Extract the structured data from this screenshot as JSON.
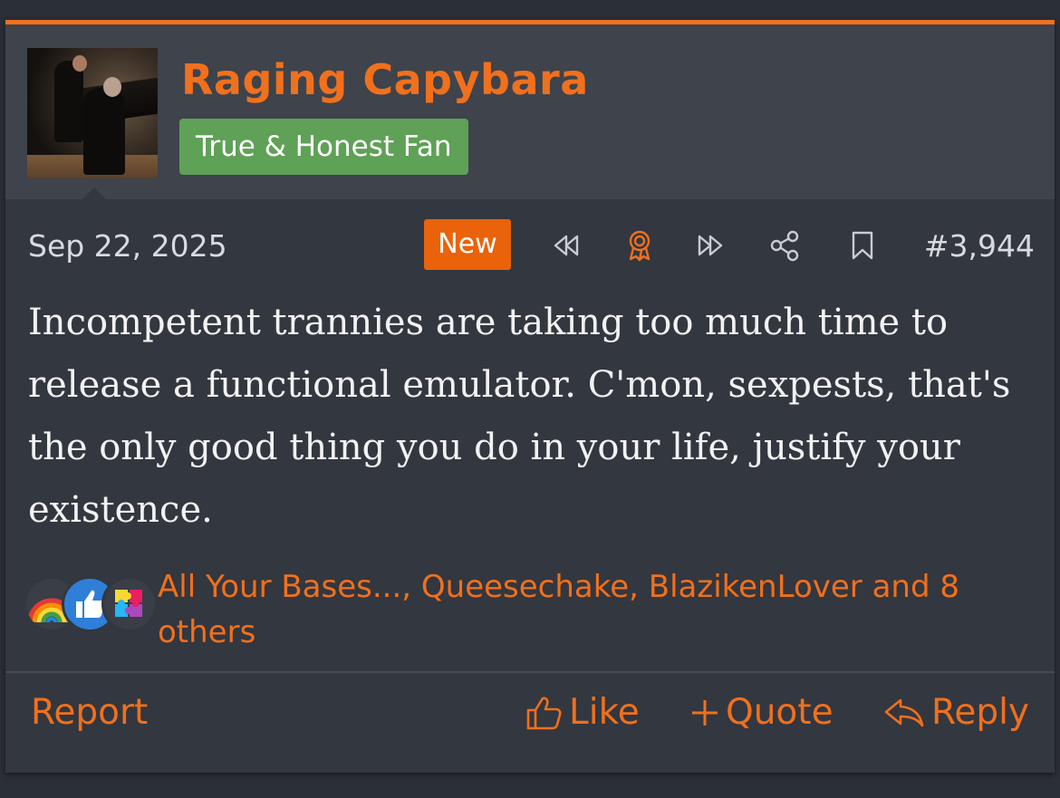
{
  "accent_color": "#f0701d",
  "user": {
    "name": "Raging Capybara",
    "title": "True & Honest Fan",
    "title_color": "#5fa157",
    "avatar_icon": "avatar-piano-photo"
  },
  "post": {
    "date": "Sep 22, 2025",
    "new_label": "New",
    "number": "#3,944",
    "toolbar_icons": [
      "rewind-icon",
      "award-icon",
      "fast-forward-icon",
      "share-icon",
      "bookmark-icon"
    ],
    "message": "Incompetent trannies are taking too much time to release a functional emulator. C'mon, sexpests, that's the only good thing you do in your life, justify your existence."
  },
  "reactions": {
    "icons": [
      "rainbow-icon",
      "thumbs-up-icon",
      "puzzle-icon"
    ],
    "users": "All Your Bases..., Queesechake, BlazikenLover and 8 others"
  },
  "actions": {
    "report": "Report",
    "like": "Like",
    "quote": "Quote",
    "reply": "Reply"
  }
}
